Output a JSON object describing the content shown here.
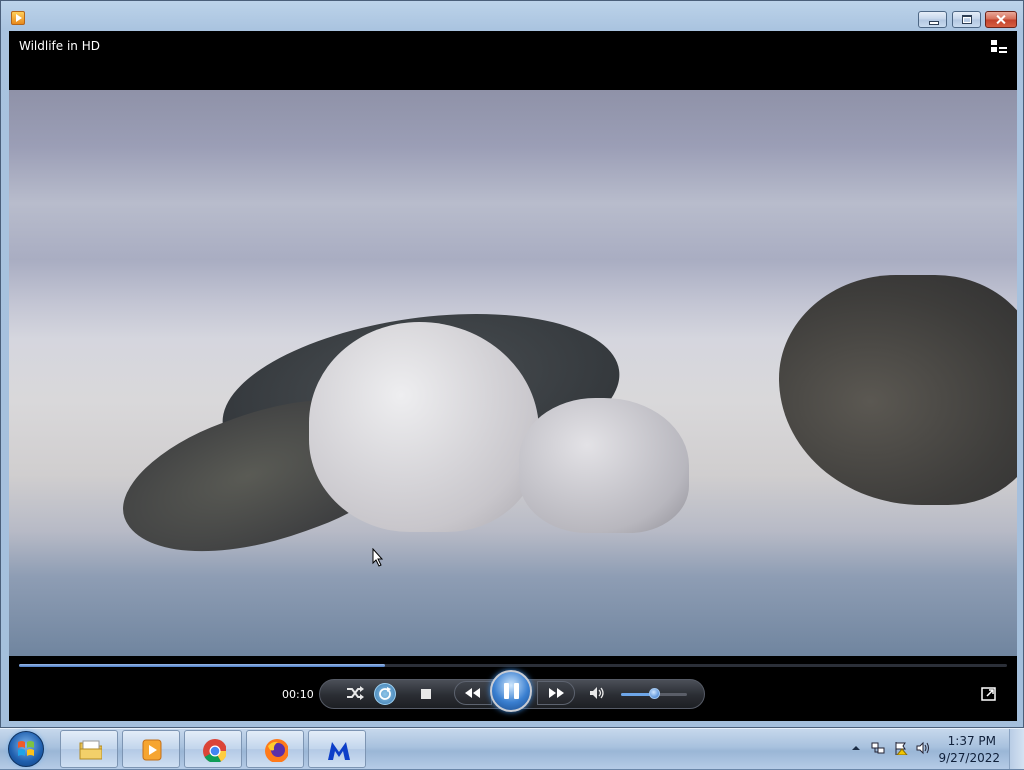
{
  "window": {
    "controls": [
      "minimize",
      "maximize",
      "close"
    ]
  },
  "player": {
    "video_title": "Wildlife in HD",
    "elapsed": "00:10",
    "seek_progress": 0.37,
    "volume_level": 0.5,
    "repeat_on": true
  },
  "taskbar": {
    "pinned": [
      "explorer-icon",
      "media-player-icon",
      "chrome-icon",
      "firefox-icon",
      "malwarebytes-icon"
    ],
    "clock_time": "1:37 PM",
    "clock_date": "9/27/2022"
  },
  "colors": {
    "accent": "#3a7fd0",
    "close": "#c2412a"
  }
}
